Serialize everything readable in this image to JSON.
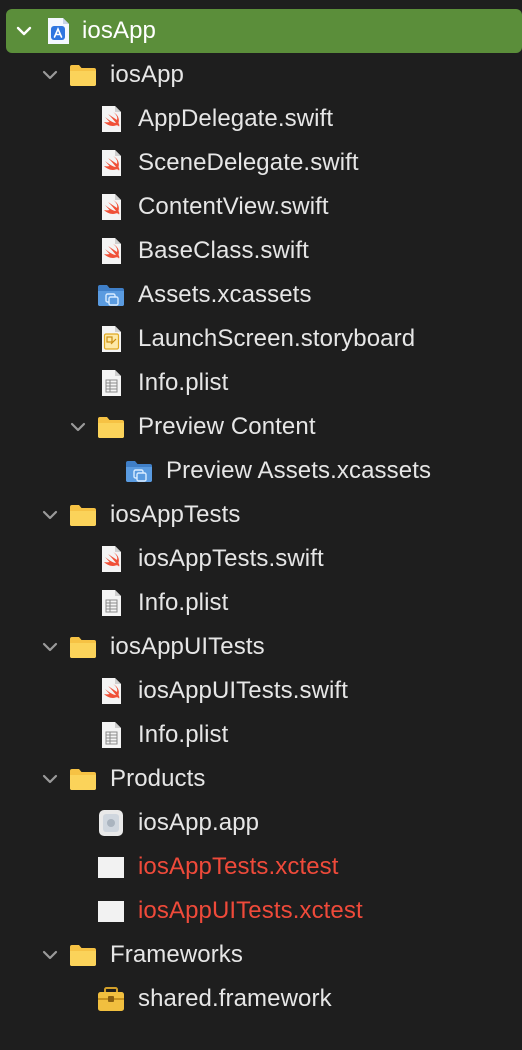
{
  "tree": {
    "project": {
      "label": "iosApp"
    },
    "group_iosApp": {
      "label": "iosApp"
    },
    "files_iosApp": [
      {
        "label": "AppDelegate.swift",
        "icon": "swift-file-icon"
      },
      {
        "label": "SceneDelegate.swift",
        "icon": "swift-file-icon"
      },
      {
        "label": "ContentView.swift",
        "icon": "swift-file-icon"
      },
      {
        "label": "BaseClass.swift",
        "icon": "swift-file-icon"
      },
      {
        "label": "Assets.xcassets",
        "icon": "asset-catalog-icon"
      },
      {
        "label": "LaunchScreen.storyboard",
        "icon": "storyboard-icon"
      },
      {
        "label": "Info.plist",
        "icon": "plist-icon"
      }
    ],
    "group_preview": {
      "label": "Preview Content"
    },
    "preview_files": [
      {
        "label": "Preview Assets.xcassets",
        "icon": "asset-catalog-icon"
      }
    ],
    "group_tests": {
      "label": "iosAppTests"
    },
    "files_tests": [
      {
        "label": "iosAppTests.swift",
        "icon": "swift-file-icon"
      },
      {
        "label": "Info.plist",
        "icon": "plist-icon"
      }
    ],
    "group_uitests": {
      "label": "iosAppUITests"
    },
    "files_uitests": [
      {
        "label": "iosAppUITests.swift",
        "icon": "swift-file-icon"
      },
      {
        "label": "Info.plist",
        "icon": "plist-icon"
      }
    ],
    "group_products": {
      "label": "Products"
    },
    "files_products": [
      {
        "label": "iosApp.app",
        "icon": "app-bundle-icon"
      },
      {
        "label": "iosAppTests.xctest",
        "icon": "xctest-bundle-icon",
        "missing": true
      },
      {
        "label": "iosAppUITests.xctest",
        "icon": "xctest-bundle-icon",
        "missing": true
      }
    ],
    "group_frameworks": {
      "label": "Frameworks"
    },
    "files_frameworks": [
      {
        "label": "shared.framework",
        "icon": "framework-icon"
      }
    ]
  },
  "colors": {
    "background": "#1e1e1e",
    "selection": "#5b8e3a",
    "text": "#e6e6e6",
    "missing_text": "#ef4a3a",
    "folder": "#f6c244",
    "swift": "#f05138",
    "asset_blue": "#4a8fd8"
  }
}
